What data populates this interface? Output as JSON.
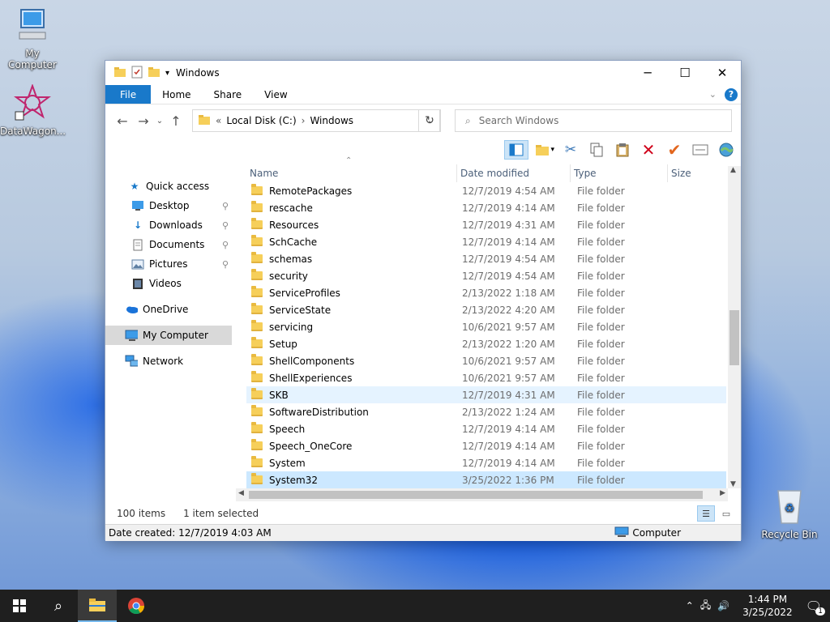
{
  "desktop": {
    "icons": [
      {
        "label": "My Computer"
      },
      {
        "label": "DataWagon..."
      },
      {
        "label": "Recycle Bin"
      }
    ]
  },
  "window": {
    "title": "Windows",
    "ribbon_tabs": [
      "File",
      "Home",
      "Share",
      "View"
    ],
    "help_label": "?",
    "address": {
      "separator": "«",
      "crumbs": [
        "Local Disk (C:)",
        "Windows"
      ],
      "chevron": "›"
    },
    "search_placeholder": "Search Windows",
    "nav": [
      {
        "label": "Quick access",
        "icon": "star-icon"
      },
      {
        "label": "Desktop",
        "icon": "desktop-icon",
        "pinned": true
      },
      {
        "label": "Downloads",
        "icon": "download-icon",
        "pinned": true
      },
      {
        "label": "Documents",
        "icon": "document-icon",
        "pinned": true
      },
      {
        "label": "Pictures",
        "icon": "pictures-icon",
        "pinned": true
      },
      {
        "label": "Videos",
        "icon": "video-icon"
      },
      {
        "label": "OneDrive",
        "icon": "cloud-icon"
      },
      {
        "label": "My Computer",
        "icon": "computer-icon",
        "selected": true
      },
      {
        "label": "Network",
        "icon": "network-icon"
      }
    ],
    "columns": [
      "Name",
      "Date modified",
      "Type",
      "Size"
    ],
    "rows": [
      {
        "name": "RemotePackages",
        "date": "12/7/2019 4:54 AM",
        "type": "File folder"
      },
      {
        "name": "rescache",
        "date": "12/7/2019 4:14 AM",
        "type": "File folder"
      },
      {
        "name": "Resources",
        "date": "12/7/2019 4:31 AM",
        "type": "File folder"
      },
      {
        "name": "SchCache",
        "date": "12/7/2019 4:14 AM",
        "type": "File folder"
      },
      {
        "name": "schemas",
        "date": "12/7/2019 4:54 AM",
        "type": "File folder"
      },
      {
        "name": "security",
        "date": "12/7/2019 4:54 AM",
        "type": "File folder"
      },
      {
        "name": "ServiceProfiles",
        "date": "2/13/2022 1:18 AM",
        "type": "File folder"
      },
      {
        "name": "ServiceState",
        "date": "2/13/2022 4:20 AM",
        "type": "File folder"
      },
      {
        "name": "servicing",
        "date": "10/6/2021 9:57 AM",
        "type": "File folder"
      },
      {
        "name": "Setup",
        "date": "2/13/2022 1:20 AM",
        "type": "File folder"
      },
      {
        "name": "ShellComponents",
        "date": "10/6/2021 9:57 AM",
        "type": "File folder"
      },
      {
        "name": "ShellExperiences",
        "date": "10/6/2021 9:57 AM",
        "type": "File folder"
      },
      {
        "name": "SKB",
        "date": "12/7/2019 4:31 AM",
        "type": "File folder",
        "state": "hover"
      },
      {
        "name": "SoftwareDistribution",
        "date": "2/13/2022 1:24 AM",
        "type": "File folder"
      },
      {
        "name": "Speech",
        "date": "12/7/2019 4:14 AM",
        "type": "File folder"
      },
      {
        "name": "Speech_OneCore",
        "date": "12/7/2019 4:14 AM",
        "type": "File folder"
      },
      {
        "name": "System",
        "date": "12/7/2019 4:14 AM",
        "type": "File folder"
      },
      {
        "name": "System32",
        "date": "3/25/2022 1:36 PM",
        "type": "File folder",
        "state": "selected"
      }
    ],
    "status": {
      "item_count": "100 items",
      "selection": "1 item selected"
    },
    "details": {
      "date_created": "Date created: 12/7/2019 4:03 AM",
      "location": "Computer"
    }
  },
  "taskbar": {
    "time": "1:44 PM",
    "date": "3/25/2022",
    "notification_count": "1"
  },
  "colors": {
    "accent": "#1979ca",
    "selection": "#cce8ff",
    "hover": "#e5f3ff",
    "folder": "#f6cf5a",
    "taskbar": "#1f1f1f"
  }
}
